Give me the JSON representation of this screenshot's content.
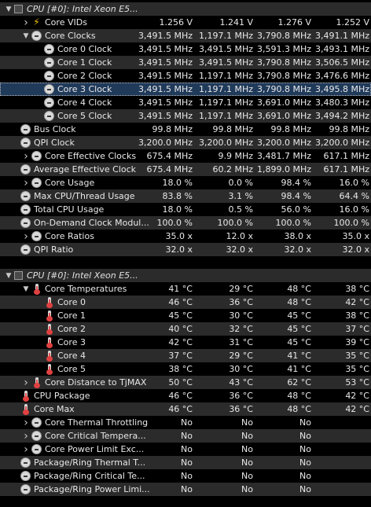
{
  "clock_section": {
    "header": "CPU [#0]: Intel Xeon E5...",
    "rows": [
      {
        "label": "Core VIDs",
        "icon": "bolt",
        "exp": "right",
        "lvl": 1,
        "v": [
          "1.256 V",
          "1.241 V",
          "1.276 V",
          "1.252 V"
        ]
      },
      {
        "label": "Core Clocks",
        "icon": "clock",
        "exp": "down",
        "lvl": 1,
        "v": [
          "3,491.5 MHz",
          "1,197.1 MHz",
          "3,790.8 MHz",
          "3,491.1 MHz"
        ]
      },
      {
        "label": "Core 0 Clock",
        "icon": "clock",
        "exp": "",
        "lvl": 2,
        "v": [
          "3,491.5 MHz",
          "3,491.5 MHz",
          "3,591.3 MHz",
          "3,493.1 MHz"
        ]
      },
      {
        "label": "Core 1 Clock",
        "icon": "clock",
        "exp": "",
        "lvl": 2,
        "v": [
          "3,491.5 MHz",
          "3,491.5 MHz",
          "3,790.8 MHz",
          "3,506.5 MHz"
        ]
      },
      {
        "label": "Core 2 Clock",
        "icon": "clock",
        "exp": "",
        "lvl": 2,
        "v": [
          "3,491.5 MHz",
          "1,197.1 MHz",
          "3,790.8 MHz",
          "3,476.6 MHz"
        ]
      },
      {
        "label": "Core 3 Clock",
        "icon": "clock",
        "exp": "",
        "lvl": 2,
        "v": [
          "3,491.5 MHz",
          "1,197.1 MHz",
          "3,790.8 MHz",
          "3,495.8 MHz"
        ],
        "selected": true
      },
      {
        "label": "Core 4 Clock",
        "icon": "clock",
        "exp": "",
        "lvl": 2,
        "v": [
          "3,491.5 MHz",
          "1,197.1 MHz",
          "3,691.0 MHz",
          "3,480.3 MHz"
        ]
      },
      {
        "label": "Core 5 Clock",
        "icon": "clock",
        "exp": "",
        "lvl": 2,
        "v": [
          "3,491.5 MHz",
          "1,197.1 MHz",
          "3,691.0 MHz",
          "3,494.2 MHz"
        ]
      },
      {
        "label": "Bus Clock",
        "icon": "clock",
        "exp": "",
        "lvl": 0,
        "v": [
          "99.8 MHz",
          "99.8 MHz",
          "99.8 MHz",
          "99.8 MHz"
        ]
      },
      {
        "label": "QPI Clock",
        "icon": "clock",
        "exp": "",
        "lvl": 0,
        "v": [
          "3,200.0 MHz",
          "3,200.0 MHz",
          "3,200.0 MHz",
          "3,200.0 MHz"
        ]
      },
      {
        "label": "Core Effective Clocks",
        "icon": "clock",
        "exp": "right",
        "lvl": 1,
        "v": [
          "675.4 MHz",
          "9.9 MHz",
          "3,481.7 MHz",
          "617.1 MHz"
        ]
      },
      {
        "label": "Average Effective Clock",
        "icon": "clock",
        "exp": "",
        "lvl": 0,
        "v": [
          "675.4 MHz",
          "60.2 MHz",
          "1,899.0 MHz",
          "617.1 MHz"
        ]
      },
      {
        "label": "Core Usage",
        "icon": "clock",
        "exp": "right",
        "lvl": 1,
        "v": [
          "18.0 %",
          "0.0 %",
          "98.4 %",
          "16.0 %"
        ]
      },
      {
        "label": "Max CPU/Thread Usage",
        "icon": "clock",
        "exp": "",
        "lvl": 0,
        "v": [
          "83.8 %",
          "3.1 %",
          "98.4 %",
          "64.4 %"
        ]
      },
      {
        "label": "Total CPU Usage",
        "icon": "clock",
        "exp": "",
        "lvl": 0,
        "v": [
          "18.0 %",
          "0.5 %",
          "56.0 %",
          "16.0 %"
        ]
      },
      {
        "label": "On-Demand Clock Modul...",
        "icon": "clock",
        "exp": "",
        "lvl": 0,
        "v": [
          "100.0 %",
          "100.0 %",
          "100.0 %",
          "100.0 %"
        ]
      },
      {
        "label": "Core Ratios",
        "icon": "clock",
        "exp": "right",
        "lvl": 1,
        "v": [
          "35.0 x",
          "12.0 x",
          "38.0 x",
          "35.0 x"
        ]
      },
      {
        "label": "QPI Ratio",
        "icon": "clock",
        "exp": "",
        "lvl": 0,
        "v": [
          "32.0 x",
          "32.0 x",
          "32.0 x",
          "32.0 x"
        ]
      }
    ]
  },
  "temp_section": {
    "header": "CPU [#0]: Intel Xeon E5...",
    "rows": [
      {
        "label": "Core Temperatures",
        "icon": "temp",
        "exp": "down",
        "lvl": 1,
        "v": [
          "41 °C",
          "29 °C",
          "48 °C",
          "38 °C"
        ]
      },
      {
        "label": "Core 0",
        "icon": "temp",
        "exp": "",
        "lvl": 2,
        "v": [
          "46 °C",
          "36 °C",
          "48 °C",
          "42 °C"
        ]
      },
      {
        "label": "Core 1",
        "icon": "temp",
        "exp": "",
        "lvl": 2,
        "v": [
          "45 °C",
          "30 °C",
          "45 °C",
          "38 °C"
        ]
      },
      {
        "label": "Core 2",
        "icon": "temp",
        "exp": "",
        "lvl": 2,
        "v": [
          "40 °C",
          "32 °C",
          "45 °C",
          "37 °C"
        ]
      },
      {
        "label": "Core 3",
        "icon": "temp",
        "exp": "",
        "lvl": 2,
        "v": [
          "42 °C",
          "31 °C",
          "45 °C",
          "39 °C"
        ]
      },
      {
        "label": "Core 4",
        "icon": "temp",
        "exp": "",
        "lvl": 2,
        "v": [
          "37 °C",
          "29 °C",
          "41 °C",
          "35 °C"
        ]
      },
      {
        "label": "Core 5",
        "icon": "temp",
        "exp": "",
        "lvl": 2,
        "v": [
          "38 °C",
          "30 °C",
          "41 °C",
          "35 °C"
        ]
      },
      {
        "label": "Core Distance to TjMAX",
        "icon": "temp",
        "exp": "right",
        "lvl": 1,
        "v": [
          "50 °C",
          "43 °C",
          "62 °C",
          "53 °C"
        ]
      },
      {
        "label": "CPU Package",
        "icon": "temp",
        "exp": "",
        "lvl": 0,
        "v": [
          "46 °C",
          "36 °C",
          "48 °C",
          "42 °C"
        ]
      },
      {
        "label": "Core Max",
        "icon": "temp",
        "exp": "",
        "lvl": 0,
        "v": [
          "46 °C",
          "36 °C",
          "48 °C",
          "42 °C"
        ]
      },
      {
        "label": "Core Thermal Throttling",
        "icon": "clock",
        "exp": "right",
        "lvl": 1,
        "v": [
          "No",
          "No",
          "No",
          ""
        ]
      },
      {
        "label": "Core Critical Tempera...",
        "icon": "clock",
        "exp": "right",
        "lvl": 1,
        "v": [
          "No",
          "No",
          "No",
          ""
        ]
      },
      {
        "label": "Core Power Limit Exc...",
        "icon": "clock",
        "exp": "right",
        "lvl": 1,
        "v": [
          "No",
          "No",
          "No",
          ""
        ]
      },
      {
        "label": "Package/Ring Thermal T...",
        "icon": "clock",
        "exp": "",
        "lvl": 0,
        "v": [
          "No",
          "No",
          "No",
          ""
        ]
      },
      {
        "label": "Package/Ring Critical Te...",
        "icon": "clock",
        "exp": "",
        "lvl": 0,
        "v": [
          "No",
          "No",
          "No",
          ""
        ]
      },
      {
        "label": "Package/Ring Power Limi...",
        "icon": "clock",
        "exp": "",
        "lvl": 0,
        "v": [
          "No",
          "No",
          "No",
          ""
        ]
      }
    ]
  },
  "colors": {
    "background": "#000000",
    "row_alt": "#2b2b2b",
    "text": "#e8e8e8",
    "selected": "#203a5a"
  }
}
